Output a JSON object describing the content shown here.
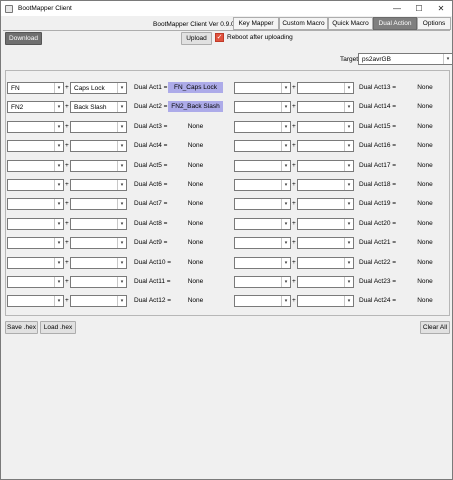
{
  "window": {
    "title": "BootMapper Client",
    "controls": {
      "minimize": "—",
      "maximize": "☐",
      "close": "✕"
    }
  },
  "header": {
    "version": "BootMapper Client Ver 0.9.0",
    "tabs": [
      {
        "label": "Key Mapper",
        "active": false
      },
      {
        "label": "Custom Macro",
        "active": false
      },
      {
        "label": "Quick Macro",
        "active": false
      },
      {
        "label": "Dual Action",
        "active": true
      },
      {
        "label": "Options",
        "active": false
      }
    ]
  },
  "toolbar": {
    "download_label": "Download",
    "upload_label": "Upload",
    "reboot_checked": true,
    "reboot_label": "Reboot after uploading"
  },
  "target": {
    "label": "Target:",
    "value": "ps2avrGB"
  },
  "plus_sign": "+",
  "arrow_glyph": "▾",
  "dual_actions": {
    "left": [
      {
        "key1": "FN",
        "key2": "Caps Lock",
        "label": "Dual Act1 =",
        "value": "FN_Caps Lock",
        "assigned": true
      },
      {
        "key1": "FN2",
        "key2": "Back Slash",
        "label": "Dual Act2 =",
        "value": "FN2_Back Slash",
        "assigned": true
      },
      {
        "key1": "",
        "key2": "",
        "label": "Dual Act3 =",
        "value": "None",
        "assigned": false
      },
      {
        "key1": "",
        "key2": "",
        "label": "Dual Act4 =",
        "value": "None",
        "assigned": false
      },
      {
        "key1": "",
        "key2": "",
        "label": "Dual Act5 =",
        "value": "None",
        "assigned": false
      },
      {
        "key1": "",
        "key2": "",
        "label": "Dual Act6 =",
        "value": "None",
        "assigned": false
      },
      {
        "key1": "",
        "key2": "",
        "label": "Dual Act7 =",
        "value": "None",
        "assigned": false
      },
      {
        "key1": "",
        "key2": "",
        "label": "Dual Act8 =",
        "value": "None",
        "assigned": false
      },
      {
        "key1": "",
        "key2": "",
        "label": "Dual Act9 =",
        "value": "None",
        "assigned": false
      },
      {
        "key1": "",
        "key2": "",
        "label": "Dual Act10 =",
        "value": "None",
        "assigned": false
      },
      {
        "key1": "",
        "key2": "",
        "label": "Dual Act11 =",
        "value": "None",
        "assigned": false
      },
      {
        "key1": "",
        "key2": "",
        "label": "Dual Act12 =",
        "value": "None",
        "assigned": false
      }
    ],
    "right": [
      {
        "key1": "",
        "key2": "",
        "label": "Dual Act13 =",
        "value": "None",
        "assigned": false
      },
      {
        "key1": "",
        "key2": "",
        "label": "Dual Act14 =",
        "value": "None",
        "assigned": false
      },
      {
        "key1": "",
        "key2": "",
        "label": "Dual Act15 =",
        "value": "None",
        "assigned": false
      },
      {
        "key1": "",
        "key2": "",
        "label": "Dual Act16 =",
        "value": "None",
        "assigned": false
      },
      {
        "key1": "",
        "key2": "",
        "label": "Dual Act17 =",
        "value": "None",
        "assigned": false
      },
      {
        "key1": "",
        "key2": "",
        "label": "Dual Act18 =",
        "value": "None",
        "assigned": false
      },
      {
        "key1": "",
        "key2": "",
        "label": "Dual Act19 =",
        "value": "None",
        "assigned": false
      },
      {
        "key1": "",
        "key2": "",
        "label": "Dual Act20 =",
        "value": "None",
        "assigned": false
      },
      {
        "key1": "",
        "key2": "",
        "label": "Dual Act21 =",
        "value": "None",
        "assigned": false
      },
      {
        "key1": "",
        "key2": "",
        "label": "Dual Act22 =",
        "value": "None",
        "assigned": false
      },
      {
        "key1": "",
        "key2": "",
        "label": "Dual Act23 =",
        "value": "None",
        "assigned": false
      },
      {
        "key1": "",
        "key2": "",
        "label": "Dual Act24 =",
        "value": "None",
        "assigned": false
      }
    ]
  },
  "footer": {
    "save_label": "Save .hex",
    "load_label": "Load .hex",
    "clear_label": "Clear All"
  },
  "colors": {
    "assigned_highlight": "#adabe9",
    "active_tab": "#7f7f7f",
    "checkbox": "#e0533f"
  }
}
